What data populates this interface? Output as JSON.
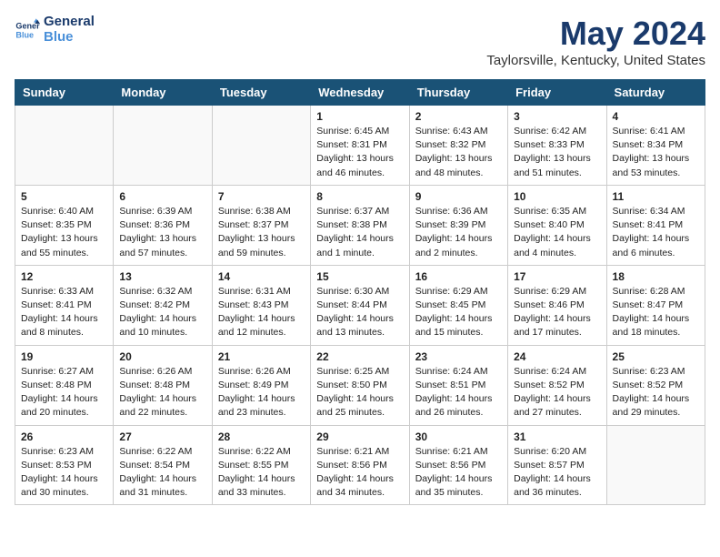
{
  "header": {
    "logo_line1": "General",
    "logo_line2": "Blue",
    "title": "May 2024",
    "subtitle": "Taylorsville, Kentucky, United States"
  },
  "days_of_week": [
    "Sunday",
    "Monday",
    "Tuesday",
    "Wednesday",
    "Thursday",
    "Friday",
    "Saturday"
  ],
  "weeks": [
    [
      {
        "day": "",
        "info": "",
        "empty": true
      },
      {
        "day": "",
        "info": "",
        "empty": true
      },
      {
        "day": "",
        "info": "",
        "empty": true
      },
      {
        "day": "1",
        "info": "Sunrise: 6:45 AM\nSunset: 8:31 PM\nDaylight: 13 hours\nand 46 minutes."
      },
      {
        "day": "2",
        "info": "Sunrise: 6:43 AM\nSunset: 8:32 PM\nDaylight: 13 hours\nand 48 minutes."
      },
      {
        "day": "3",
        "info": "Sunrise: 6:42 AM\nSunset: 8:33 PM\nDaylight: 13 hours\nand 51 minutes."
      },
      {
        "day": "4",
        "info": "Sunrise: 6:41 AM\nSunset: 8:34 PM\nDaylight: 13 hours\nand 53 minutes."
      }
    ],
    [
      {
        "day": "5",
        "info": "Sunrise: 6:40 AM\nSunset: 8:35 PM\nDaylight: 13 hours\nand 55 minutes."
      },
      {
        "day": "6",
        "info": "Sunrise: 6:39 AM\nSunset: 8:36 PM\nDaylight: 13 hours\nand 57 minutes."
      },
      {
        "day": "7",
        "info": "Sunrise: 6:38 AM\nSunset: 8:37 PM\nDaylight: 13 hours\nand 59 minutes."
      },
      {
        "day": "8",
        "info": "Sunrise: 6:37 AM\nSunset: 8:38 PM\nDaylight: 14 hours\nand 1 minute."
      },
      {
        "day": "9",
        "info": "Sunrise: 6:36 AM\nSunset: 8:39 PM\nDaylight: 14 hours\nand 2 minutes."
      },
      {
        "day": "10",
        "info": "Sunrise: 6:35 AM\nSunset: 8:40 PM\nDaylight: 14 hours\nand 4 minutes."
      },
      {
        "day": "11",
        "info": "Sunrise: 6:34 AM\nSunset: 8:41 PM\nDaylight: 14 hours\nand 6 minutes."
      }
    ],
    [
      {
        "day": "12",
        "info": "Sunrise: 6:33 AM\nSunset: 8:41 PM\nDaylight: 14 hours\nand 8 minutes."
      },
      {
        "day": "13",
        "info": "Sunrise: 6:32 AM\nSunset: 8:42 PM\nDaylight: 14 hours\nand 10 minutes."
      },
      {
        "day": "14",
        "info": "Sunrise: 6:31 AM\nSunset: 8:43 PM\nDaylight: 14 hours\nand 12 minutes."
      },
      {
        "day": "15",
        "info": "Sunrise: 6:30 AM\nSunset: 8:44 PM\nDaylight: 14 hours\nand 13 minutes."
      },
      {
        "day": "16",
        "info": "Sunrise: 6:29 AM\nSunset: 8:45 PM\nDaylight: 14 hours\nand 15 minutes."
      },
      {
        "day": "17",
        "info": "Sunrise: 6:29 AM\nSunset: 8:46 PM\nDaylight: 14 hours\nand 17 minutes."
      },
      {
        "day": "18",
        "info": "Sunrise: 6:28 AM\nSunset: 8:47 PM\nDaylight: 14 hours\nand 18 minutes."
      }
    ],
    [
      {
        "day": "19",
        "info": "Sunrise: 6:27 AM\nSunset: 8:48 PM\nDaylight: 14 hours\nand 20 minutes."
      },
      {
        "day": "20",
        "info": "Sunrise: 6:26 AM\nSunset: 8:48 PM\nDaylight: 14 hours\nand 22 minutes."
      },
      {
        "day": "21",
        "info": "Sunrise: 6:26 AM\nSunset: 8:49 PM\nDaylight: 14 hours\nand 23 minutes."
      },
      {
        "day": "22",
        "info": "Sunrise: 6:25 AM\nSunset: 8:50 PM\nDaylight: 14 hours\nand 25 minutes."
      },
      {
        "day": "23",
        "info": "Sunrise: 6:24 AM\nSunset: 8:51 PM\nDaylight: 14 hours\nand 26 minutes."
      },
      {
        "day": "24",
        "info": "Sunrise: 6:24 AM\nSunset: 8:52 PM\nDaylight: 14 hours\nand 27 minutes."
      },
      {
        "day": "25",
        "info": "Sunrise: 6:23 AM\nSunset: 8:52 PM\nDaylight: 14 hours\nand 29 minutes."
      }
    ],
    [
      {
        "day": "26",
        "info": "Sunrise: 6:23 AM\nSunset: 8:53 PM\nDaylight: 14 hours\nand 30 minutes."
      },
      {
        "day": "27",
        "info": "Sunrise: 6:22 AM\nSunset: 8:54 PM\nDaylight: 14 hours\nand 31 minutes."
      },
      {
        "day": "28",
        "info": "Sunrise: 6:22 AM\nSunset: 8:55 PM\nDaylight: 14 hours\nand 33 minutes."
      },
      {
        "day": "29",
        "info": "Sunrise: 6:21 AM\nSunset: 8:56 PM\nDaylight: 14 hours\nand 34 minutes."
      },
      {
        "day": "30",
        "info": "Sunrise: 6:21 AM\nSunset: 8:56 PM\nDaylight: 14 hours\nand 35 minutes."
      },
      {
        "day": "31",
        "info": "Sunrise: 6:20 AM\nSunset: 8:57 PM\nDaylight: 14 hours\nand 36 minutes."
      },
      {
        "day": "",
        "info": "",
        "empty": true
      }
    ]
  ]
}
